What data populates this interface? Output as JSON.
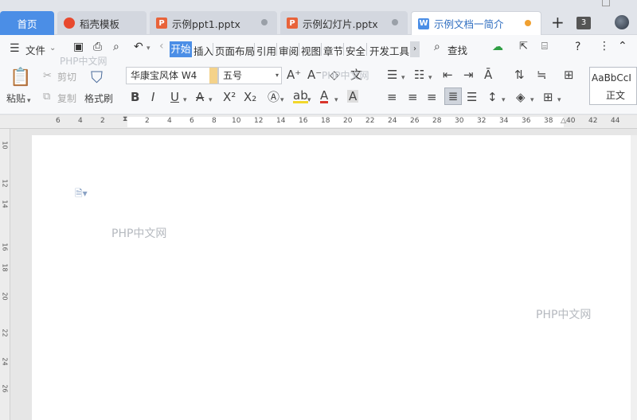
{
  "tabs": {
    "home": "首页",
    "items": [
      {
        "label": "稻壳模板",
        "icon": "D"
      },
      {
        "label": "示例ppt1.pptx",
        "icon": "P"
      },
      {
        "label": "示例幻灯片.pptx",
        "icon": "P"
      },
      {
        "label": "示例文档一简介",
        "icon": "W"
      }
    ],
    "add": "+",
    "count": "3"
  },
  "menu": {
    "file": "文件",
    "ribbon_tabs": [
      "开始",
      "插入",
      "页面布局",
      "引用",
      "审阅",
      "视图",
      "章节",
      "安全",
      "开发工具"
    ],
    "search": "查找"
  },
  "ribbon": {
    "paste": "粘贴",
    "cut": "剪切",
    "copy": "复制",
    "format_painter": "格式刷",
    "font_name": "华康宝风体 W4",
    "font_size": "五号",
    "style_preview": "AaBbCcI",
    "style_name": "正文"
  },
  "ruler": {
    "top_ticks": [
      "6",
      "4",
      "2",
      "2",
      "4",
      "6",
      "8",
      "10",
      "12",
      "14",
      "16",
      "18",
      "20",
      "22",
      "24",
      "26",
      "28",
      "30",
      "32",
      "34",
      "36",
      "38",
      "40",
      "42",
      "44"
    ],
    "left_ticks": [
      "10",
      "12",
      "14",
      "16",
      "18",
      "20",
      "22",
      "24",
      "26"
    ]
  },
  "watermarks": [
    "PHP中文网",
    "PHP中文网",
    "PHP中文网",
    "PHP中文网"
  ],
  "colors": {
    "accent": "#4b8ee6",
    "tab_bg": "#d3d7df",
    "active_tab_dot": "#f0a030"
  }
}
